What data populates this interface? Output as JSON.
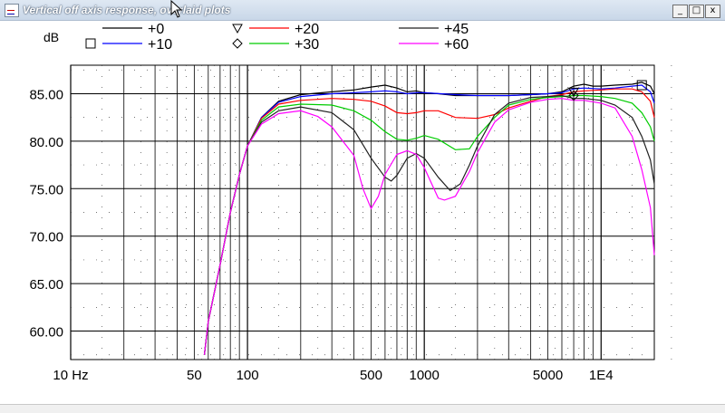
{
  "window": {
    "title": "Vertical off axis response, overlaid plots",
    "min_glyph": "_",
    "max_glyph": "□",
    "close_glyph": "x"
  },
  "chart_data": {
    "type": "line",
    "ylabel": "dB",
    "xscale": "log",
    "xlim": [
      10,
      20000
    ],
    "ylim": [
      57,
      88
    ],
    "yticks": [
      60,
      65,
      70,
      75,
      80,
      85
    ],
    "ytick_labels": [
      "60.00",
      "65.00",
      "70.00",
      "75.00",
      "80.00",
      "85.00"
    ],
    "xticks": [
      10,
      50,
      100,
      500,
      1000,
      5000,
      10000
    ],
    "xtick_labels": [
      "10 Hz",
      "50",
      "100",
      "500",
      "1000",
      "5000",
      "1E4"
    ],
    "grid": true,
    "legend": "top",
    "series": [
      {
        "name": "+0",
        "color": "#000000",
        "marker": "",
        "points": [
          [
            57,
            57.5
          ],
          [
            60,
            61
          ],
          [
            70,
            67
          ],
          [
            80,
            72.5
          ],
          [
            90,
            76.5
          ],
          [
            100,
            79.5
          ],
          [
            120,
            82.5
          ],
          [
            150,
            84.2
          ],
          [
            200,
            84.9
          ],
          [
            300,
            85.2
          ],
          [
            400,
            85.4
          ],
          [
            500,
            85.7
          ],
          [
            600,
            85.9
          ],
          [
            700,
            85.6
          ],
          [
            800,
            85.2
          ],
          [
            900,
            85.3
          ],
          [
            1000,
            85.1
          ],
          [
            1200,
            85
          ],
          [
            1500,
            84.8
          ],
          [
            2000,
            84.8
          ],
          [
            3000,
            84.8
          ],
          [
            4000,
            84.9
          ],
          [
            5000,
            85
          ],
          [
            6000,
            85.2
          ],
          [
            7000,
            85.8
          ],
          [
            8000,
            86
          ],
          [
            9000,
            85.8
          ],
          [
            10000,
            85.8
          ],
          [
            12000,
            85.9
          ],
          [
            15000,
            86
          ],
          [
            17000,
            86.2
          ],
          [
            19000,
            85.8
          ],
          [
            20000,
            85
          ]
        ]
      },
      {
        "name": "+10",
        "color": "#0000ff",
        "marker": "square",
        "points": [
          [
            57,
            57.5
          ],
          [
            60,
            61
          ],
          [
            70,
            67
          ],
          [
            80,
            72.5
          ],
          [
            90,
            76.5
          ],
          [
            100,
            79.5
          ],
          [
            120,
            82.5
          ],
          [
            150,
            84.1
          ],
          [
            200,
            84.7
          ],
          [
            300,
            85
          ],
          [
            400,
            85.1
          ],
          [
            500,
            85.2
          ],
          [
            600,
            85.3
          ],
          [
            700,
            85.2
          ],
          [
            800,
            85
          ],
          [
            900,
            85.1
          ],
          [
            1000,
            85.1
          ],
          [
            1500,
            84.9
          ],
          [
            2000,
            84.8
          ],
          [
            3000,
            84.8
          ],
          [
            4000,
            84.9
          ],
          [
            5000,
            85
          ],
          [
            6000,
            85.1
          ],
          [
            7000,
            85.5
          ],
          [
            8000,
            85.6
          ],
          [
            10000,
            85.5
          ],
          [
            12000,
            85.6
          ],
          [
            15000,
            85.8
          ],
          [
            17000,
            85.9
          ],
          [
            19000,
            85.2
          ],
          [
            20000,
            84
          ]
        ]
      },
      {
        "name": "+20",
        "color": "#ff0000",
        "marker": "triangle",
        "points": [
          [
            57,
            57.5
          ],
          [
            60,
            61
          ],
          [
            70,
            67
          ],
          [
            80,
            72.5
          ],
          [
            90,
            76.5
          ],
          [
            100,
            79.5
          ],
          [
            120,
            82.4
          ],
          [
            150,
            83.9
          ],
          [
            200,
            84.3
          ],
          [
            300,
            84.5
          ],
          [
            400,
            84.4
          ],
          [
            500,
            84.2
          ],
          [
            600,
            83.7
          ],
          [
            700,
            83
          ],
          [
            800,
            82.9
          ],
          [
            900,
            83
          ],
          [
            1000,
            83.2
          ],
          [
            1200,
            83.2
          ],
          [
            1500,
            82.5
          ],
          [
            2000,
            82.4
          ],
          [
            2500,
            82.8
          ],
          [
            3000,
            83.5
          ],
          [
            4000,
            84.2
          ],
          [
            5000,
            84.7
          ],
          [
            6000,
            84.9
          ],
          [
            7000,
            85.2
          ],
          [
            8000,
            85.3
          ],
          [
            10000,
            85.4
          ],
          [
            12000,
            85.5
          ],
          [
            15000,
            85.5
          ],
          [
            17000,
            85.2
          ],
          [
            19000,
            84.2
          ],
          [
            20000,
            82.5
          ]
        ]
      },
      {
        "name": "+30",
        "color": "#00cc00",
        "marker": "diamond",
        "points": [
          [
            57,
            57.5
          ],
          [
            60,
            61
          ],
          [
            70,
            67
          ],
          [
            80,
            72.5
          ],
          [
            90,
            76.5
          ],
          [
            100,
            79.5
          ],
          [
            120,
            82.2
          ],
          [
            150,
            83.6
          ],
          [
            200,
            83.9
          ],
          [
            300,
            83.8
          ],
          [
            400,
            83.2
          ],
          [
            500,
            82.2
          ],
          [
            600,
            81
          ],
          [
            700,
            80.2
          ],
          [
            800,
            80.1
          ],
          [
            900,
            80.3
          ],
          [
            1000,
            80.6
          ],
          [
            1200,
            80.2
          ],
          [
            1500,
            79.1
          ],
          [
            1800,
            79.2
          ],
          [
            2000,
            80.5
          ],
          [
            2500,
            82.5
          ],
          [
            3000,
            83.8
          ],
          [
            4000,
            84.4
          ],
          [
            5000,
            84.6
          ],
          [
            6000,
            84.7
          ],
          [
            7000,
            84.8
          ],
          [
            8000,
            84.8
          ],
          [
            10000,
            84.7
          ],
          [
            12000,
            84.5
          ],
          [
            15000,
            84
          ],
          [
            17000,
            83
          ],
          [
            19000,
            81.5
          ],
          [
            20000,
            80
          ]
        ]
      },
      {
        "name": "+45",
        "color": "#202020",
        "marker": "",
        "points": [
          [
            57,
            57.5
          ],
          [
            60,
            61
          ],
          [
            70,
            67
          ],
          [
            80,
            72.5
          ],
          [
            90,
            76.5
          ],
          [
            100,
            79.5
          ],
          [
            120,
            82
          ],
          [
            150,
            83.2
          ],
          [
            200,
            83.6
          ],
          [
            300,
            83
          ],
          [
            400,
            81.2
          ],
          [
            500,
            78.2
          ],
          [
            600,
            76.2
          ],
          [
            650,
            75.8
          ],
          [
            700,
            76.4
          ],
          [
            800,
            78.2
          ],
          [
            900,
            78.7
          ],
          [
            1000,
            78.2
          ],
          [
            1200,
            76.2
          ],
          [
            1400,
            74.8
          ],
          [
            1600,
            75.5
          ],
          [
            1800,
            77.5
          ],
          [
            2000,
            79.5
          ],
          [
            2500,
            82.8
          ],
          [
            3000,
            84
          ],
          [
            4000,
            84.6
          ],
          [
            5000,
            84.7
          ],
          [
            6000,
            84.8
          ],
          [
            7000,
            84.5
          ],
          [
            8000,
            84.5
          ],
          [
            10000,
            84.3
          ],
          [
            12000,
            83.8
          ],
          [
            15000,
            82.5
          ],
          [
            17000,
            80.5
          ],
          [
            19000,
            78
          ],
          [
            20000,
            75.5
          ]
        ]
      },
      {
        "name": "+60",
        "color": "#ff00ff",
        "marker": "",
        "points": [
          [
            57,
            57.5
          ],
          [
            60,
            61
          ],
          [
            70,
            67
          ],
          [
            80,
            72.5
          ],
          [
            90,
            76.5
          ],
          [
            100,
            79.5
          ],
          [
            120,
            81.8
          ],
          [
            150,
            82.9
          ],
          [
            200,
            83.2
          ],
          [
            250,
            82.6
          ],
          [
            300,
            81.5
          ],
          [
            400,
            78.5
          ],
          [
            450,
            75
          ],
          [
            500,
            72.9
          ],
          [
            550,
            74.2
          ],
          [
            600,
            76.5
          ],
          [
            700,
            78.6
          ],
          [
            800,
            79
          ],
          [
            900,
            78.6
          ],
          [
            1000,
            77.2
          ],
          [
            1200,
            74
          ],
          [
            1300,
            73.8
          ],
          [
            1500,
            74.2
          ],
          [
            1800,
            76.8
          ],
          [
            2000,
            78.8
          ],
          [
            2500,
            82
          ],
          [
            3000,
            83.3
          ],
          [
            4000,
            84.1
          ],
          [
            5000,
            84.4
          ],
          [
            6000,
            84.5
          ],
          [
            7000,
            84.3
          ],
          [
            8000,
            84.3
          ],
          [
            10000,
            84
          ],
          [
            12000,
            83.5
          ],
          [
            15000,
            80.5
          ],
          [
            17000,
            77
          ],
          [
            19000,
            73
          ],
          [
            20000,
            68
          ]
        ]
      }
    ]
  }
}
